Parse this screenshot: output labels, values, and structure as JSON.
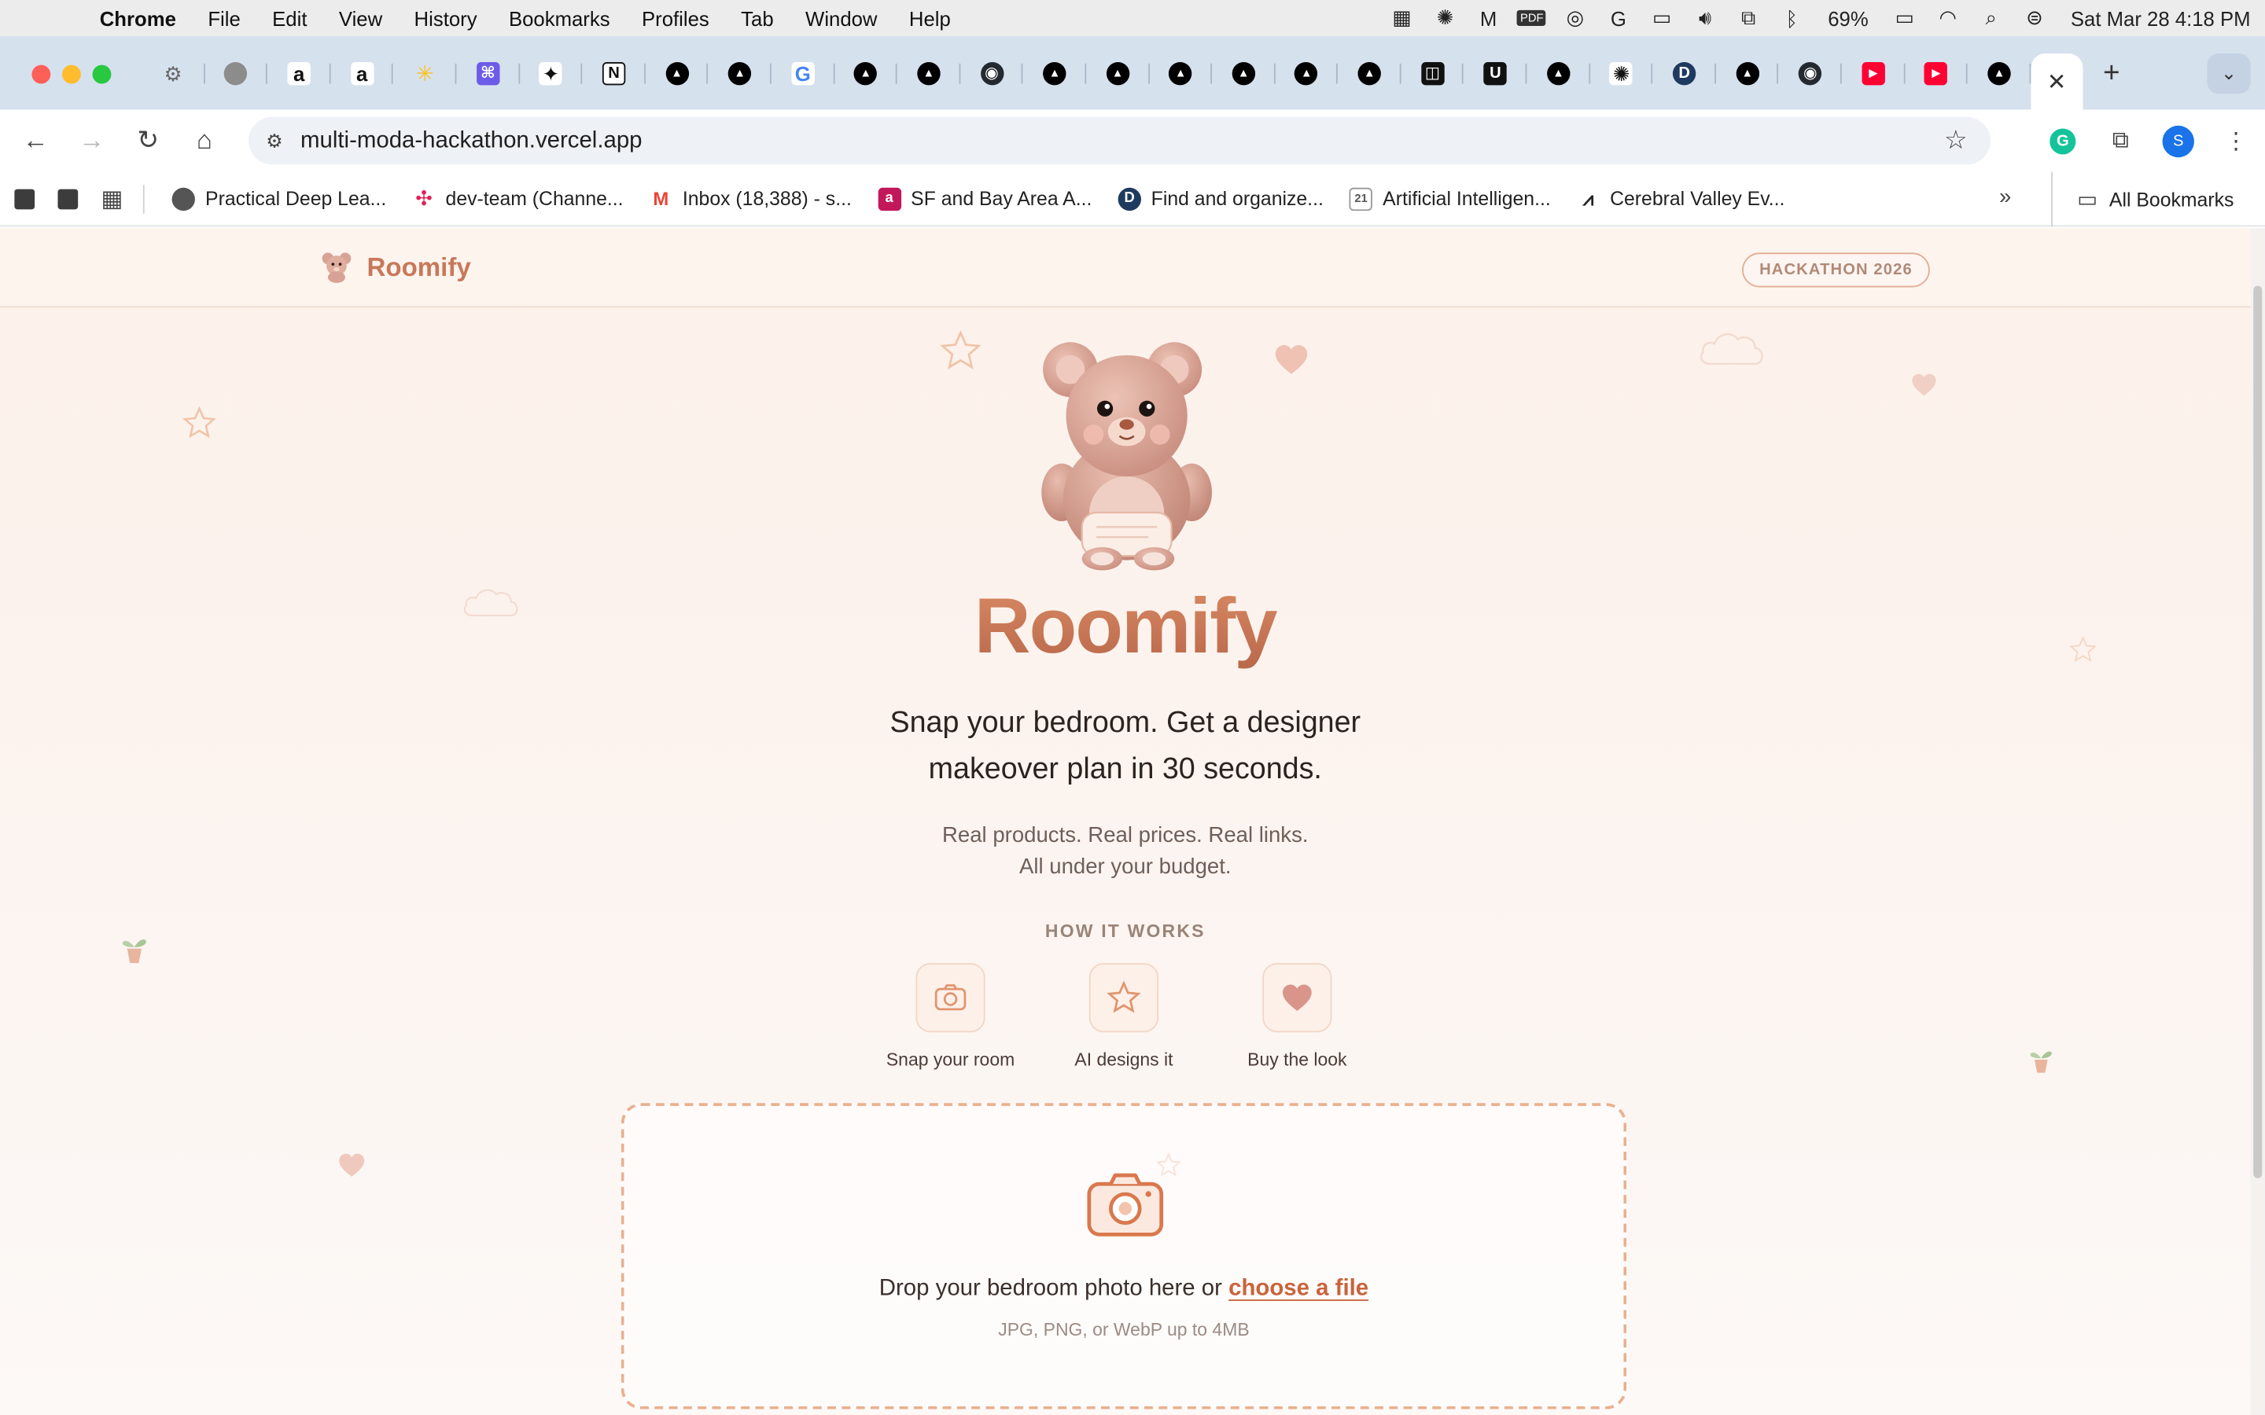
{
  "menubar": {
    "app_name": "Chrome",
    "items": [
      "File",
      "Edit",
      "View",
      "History",
      "Bookmarks",
      "Profiles",
      "Tab",
      "Window",
      "Help"
    ],
    "battery": "69%",
    "datetime": "Sat Mar 28  4:18 PM"
  },
  "browser": {
    "url": "multi-moda-hackathon.vercel.app",
    "profile_initial": "S",
    "bookmarks": [
      {
        "label": "Practical Deep Lea...",
        "icon": "globe-icon",
        "color": "#555555"
      },
      {
        "label": "dev-team (Channe...",
        "icon": "slack-icon",
        "color": "#e01e5a"
      },
      {
        "label": "Inbox (18,388) - s...",
        "icon": "gmail-icon",
        "color": "#ea4335"
      },
      {
        "label": "SF and Bay Area A...",
        "icon": "a-icon",
        "color": "#c2185b"
      },
      {
        "label": "Find and organize...",
        "icon": "d-icon",
        "color": "#1e3a5f"
      },
      {
        "label": "Artificial Intelligen...",
        "icon": "calendar-icon",
        "color": "#777777"
      },
      {
        "label": "Cerebral Valley Ev...",
        "icon": "cv-icon",
        "color": "#222222"
      }
    ],
    "all_bookmarks": "All Bookmarks"
  },
  "site": {
    "brand": "Roomify",
    "badge": "HACKATHON 2026",
    "title": "Roomify",
    "tagline_line1": "Snap your bedroom. Get a designer",
    "tagline_line2": "makeover plan in 30 seconds.",
    "subtag_line1": "Real products. Real prices. Real links.",
    "subtag_line2": "All under your budget.",
    "how_it_works": "HOW IT WORKS",
    "steps": [
      {
        "label": "Snap your room",
        "icon": "camera-icon"
      },
      {
        "label": "AI designs it",
        "icon": "star-icon"
      },
      {
        "label": "Buy the look",
        "icon": "heart-icon"
      }
    ],
    "dropzone": {
      "text": "Drop your bedroom photo here or ",
      "link": "choose a file",
      "hint": "JPG, PNG, or WebP up to 4MB"
    },
    "accent": "#c8785a"
  }
}
